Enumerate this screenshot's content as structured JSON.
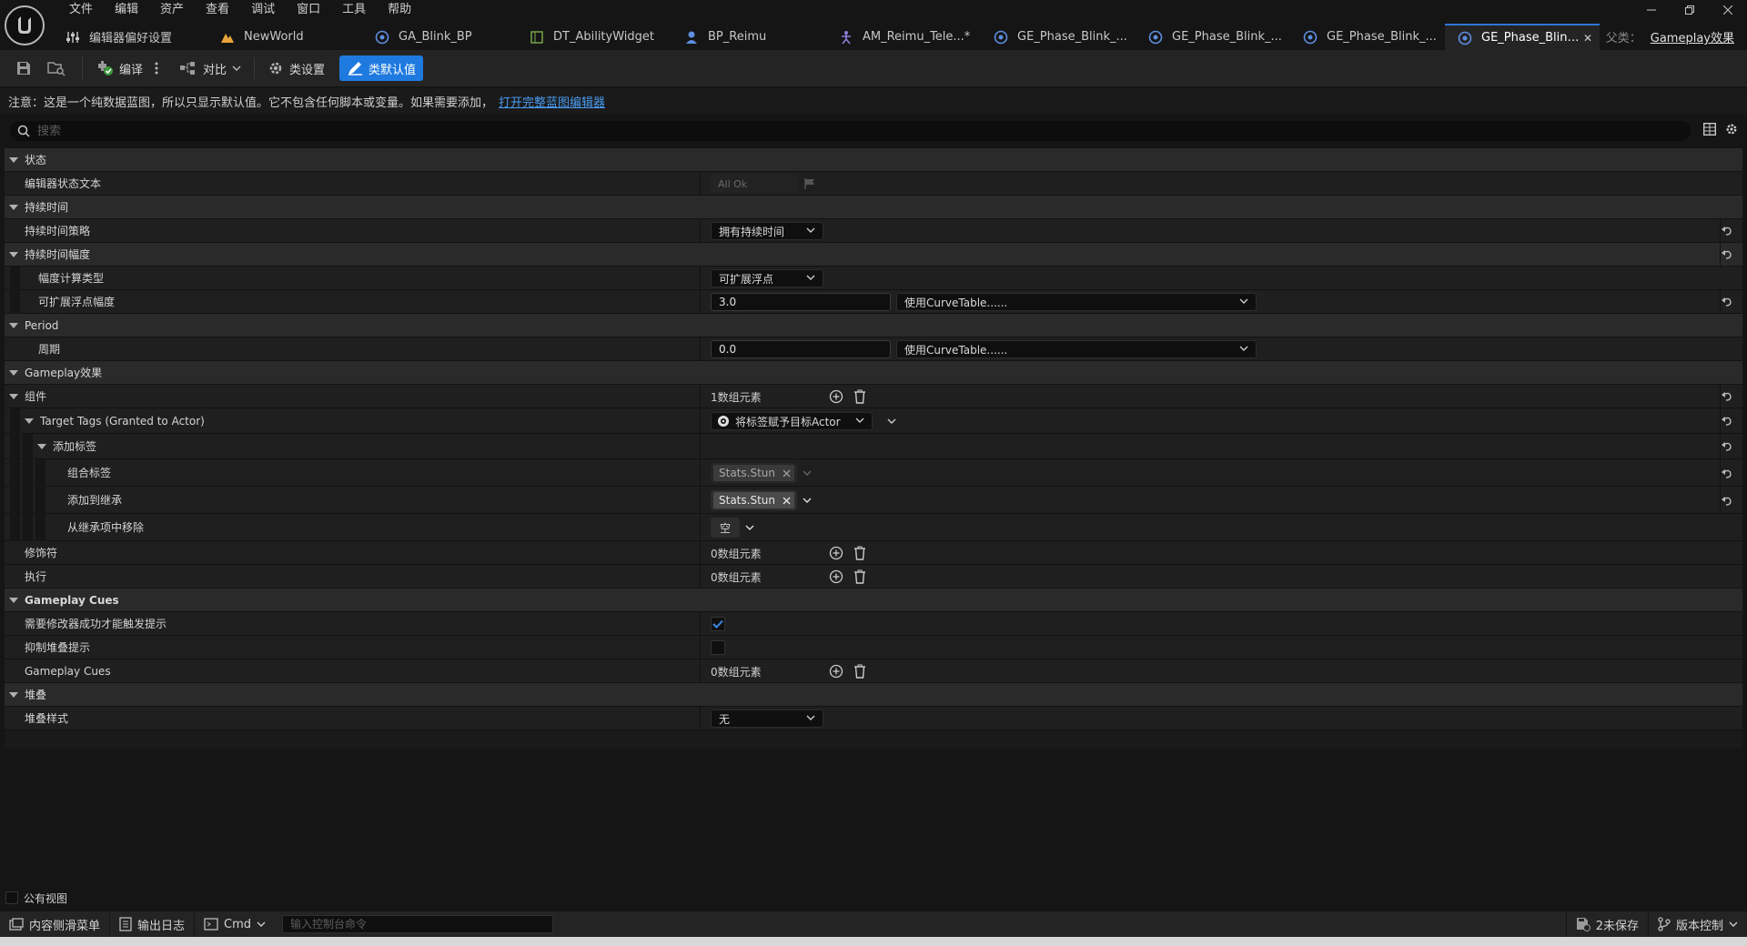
{
  "menu": [
    "文件",
    "编辑",
    "资产",
    "查看",
    "调试",
    "窗口",
    "工具",
    "帮助"
  ],
  "tabs": [
    {
      "label": "编辑器偏好设置",
      "icon": "sliders-icon"
    },
    {
      "label": "NewWorld",
      "icon": "level-icon"
    },
    {
      "label": "GA_Blink_BP",
      "icon": "gameplay-ability-icon"
    },
    {
      "label": "DT_AbilityWidget",
      "icon": "data-table-icon"
    },
    {
      "label": "BP_Reimu",
      "icon": "character-icon"
    },
    {
      "label": "AM_Reimu_Tele...*",
      "icon": "anim-montage-icon"
    },
    {
      "label": "GE_Phase_Blink_...",
      "icon": "gameplay-effect-icon"
    },
    {
      "label": "GE_Phase_Blink_...",
      "icon": "gameplay-effect-icon"
    },
    {
      "label": "GE_Phase_Blink_...",
      "icon": "gameplay-effect-icon"
    },
    {
      "label": "GE_Phase_Blink_...",
      "icon": "gameplay-effect-icon",
      "active": true
    }
  ],
  "parent": {
    "label": "父类：",
    "value": "Gameplay效果"
  },
  "toolbar": {
    "compile": "编译",
    "diff": "对比",
    "class_settings": "类设置",
    "class_defaults": "类默认值"
  },
  "notice": {
    "text": "注意：这是一个纯数据蓝图，所以只显示默认值。它不包含任何脚本或变量。如果需要添加，",
    "link": "打开完整蓝图编辑器"
  },
  "search": {
    "placeholder": "搜索"
  },
  "details": {
    "state": {
      "title": "状态",
      "editor_state_label": "编辑器状态文本",
      "editor_state_value": "All Ok"
    },
    "duration": {
      "title": "持续时间",
      "policy_label": "持续时间策略",
      "policy_value": "拥有持续时间",
      "magnitude_title": "持续时间幅度",
      "calc_type_label": "幅度计算类型",
      "calc_type_value": "可扩展浮点",
      "scalable_label": "可扩展浮点幅度",
      "scalable_value": "3.0",
      "curve_value": "使用CurveTable......"
    },
    "period": {
      "title": "Period",
      "period_label": "周期",
      "period_value": "0.0",
      "curve_value": "使用CurveTable......"
    },
    "gameplay_effect": {
      "title": "Gameplay效果",
      "components_label": "组件",
      "components_count": "1数组元素",
      "target_tags_label": "Target Tags (Granted to Actor)",
      "target_tags_value": "将标签赋予目标Actor",
      "add_tags_label": "添加标签",
      "combined_tags_label": "组合标签",
      "combined_tag": "Stats.Stun",
      "add_inherit_label": "添加到继承",
      "add_inherit_tag": "Stats.Stun",
      "remove_inherit_label": "从继承项中移除",
      "remove_inherit_value": "空",
      "modifiers_label": "修饰符",
      "modifiers_count": "0数组元素",
      "executions_label": "执行",
      "executions_count": "0数组元素"
    },
    "cues": {
      "title": "Gameplay Cues",
      "require_success_label": "需要修改器成功才能触发提示",
      "require_success_checked": true,
      "suppress_stack_label": "抑制堆叠提示",
      "suppress_stack_checked": false,
      "cues_label": "Gameplay Cues",
      "cues_count": "0数组元素"
    },
    "stacking": {
      "title": "堆叠",
      "style_label": "堆叠样式",
      "style_value": "无"
    }
  },
  "public_view": "公有视图",
  "statusbar": {
    "content_drawer": "内容侧滑菜单",
    "output_log": "输出日志",
    "cmd": "Cmd",
    "console_placeholder": "输入控制台命令",
    "unsaved": "2未保存",
    "source_control": "版本控制"
  },
  "colors": {
    "accent": "#1f7ae0",
    "link": "#4a9cf0",
    "check": "#2f76d8"
  }
}
